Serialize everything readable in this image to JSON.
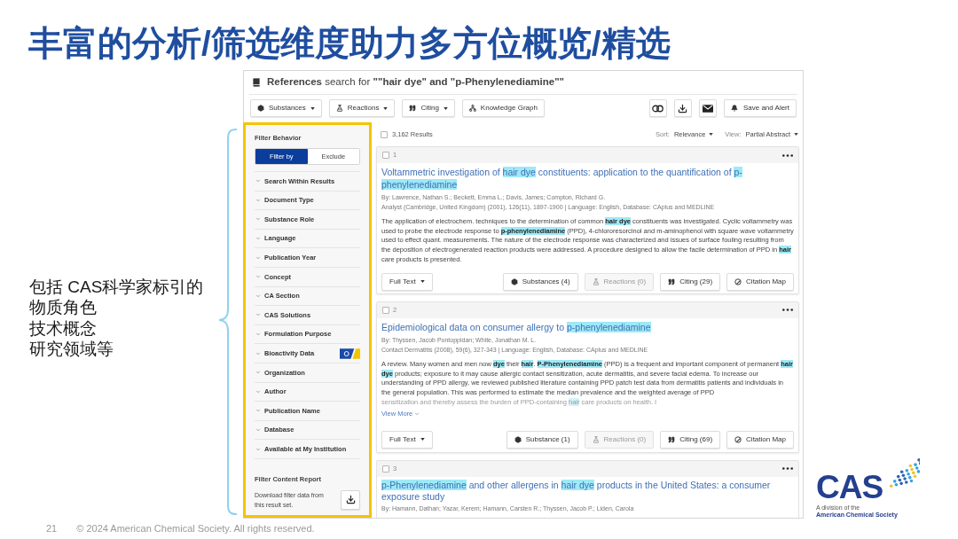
{
  "slide": {
    "title": "丰富的分析/筛选维度助力多方位概览/精选",
    "note_lines": [
      "包括 CAS科学家标引的",
      "物质角色",
      "技术概念",
      "研究领域等"
    ]
  },
  "screen": {
    "heading": "**References** search for **\"\"hair dye\" and \"p-Phenylenediamine\"\"**",
    "toolbar": [
      {
        "label": "Substances",
        "kind": "substances",
        "dropdown": true
      },
      {
        "label": "Reactions",
        "kind": "reactions",
        "dropdown": true
      },
      {
        "label": "Citing",
        "kind": "citing",
        "dropdown": true
      },
      {
        "label": "Knowledge Graph",
        "kind": "graph",
        "dropdown": false
      }
    ],
    "toolbar_right": [
      {
        "kind": "combine"
      },
      {
        "kind": "download"
      },
      {
        "kind": "email"
      },
      {
        "kind": "alert",
        "label": "Save and Alert"
      }
    ]
  },
  "filters": {
    "behavior": {
      "title": "Filter Behavior",
      "options": [
        {
          "label": "Filter by",
          "selected": true
        },
        {
          "label": "Exclude",
          "selected": false
        }
      ]
    },
    "items": [
      {
        "label": "Search Within Results",
        "badge": false
      },
      {
        "label": "Document Type",
        "badge": false
      },
      {
        "label": "Substance Role",
        "badge": false
      },
      {
        "label": "Language",
        "badge": false
      },
      {
        "label": "Publication Year",
        "badge": false
      },
      {
        "label": "Concept",
        "badge": false
      },
      {
        "label": "CA Section",
        "badge": false
      },
      {
        "label": "CAS Solutions",
        "badge": false
      },
      {
        "label": "Formulation Purpose",
        "badge": false
      },
      {
        "label": "Bioactivity Data",
        "badge": true
      },
      {
        "label": "Organization",
        "badge": false
      },
      {
        "label": "Author",
        "badge": false
      },
      {
        "label": "Publication Name",
        "badge": false
      },
      {
        "label": "Database",
        "badge": false
      },
      {
        "label": "Available at My Institution",
        "badge": false
      }
    ],
    "report": {
      "title": "Filter Content Report",
      "text": "Download filter data from this result set."
    }
  },
  "results": {
    "count": "3,162 Results",
    "checked": false,
    "sort": {
      "label": "Sort:",
      "value": "Relevance"
    },
    "view": {
      "label": "View:",
      "value": "Partial Abstract"
    },
    "cards": [
      {
        "number": "1",
        "checked": false,
        "title": [
          {
            "text": "Voltammetric investigation of ",
            "highlighted": false
          },
          {
            "text": "hair dye",
            "highlighted": true
          },
          {
            "text": " constituents: application to the quantification of ",
            "highlighted": false
          },
          {
            "text": "p-phenylenediamine",
            "highlighted": true
          }
        ],
        "authors": "By: Lawrence, Nathan S.; Beckett, Emma L.; Davis, James; Compton, Richard G.",
        "source": "Analyst (Cambridge, United Kingdom) (2001), 126(11), 1897-1900 | Language: English, Database: CAplus and MEDLINE",
        "abstract": [
          {
            "text": "The application of electrochem. techniques to the determination of common ",
            "highlighted": false
          },
          {
            "text": "hair dye",
            "highlighted": true
          },
          {
            "text": " constituents was investigated. Cyclic voltammetry was used to probe the electrode response to ",
            "highlighted": false
          },
          {
            "text": "p-phenylenediamine",
            "highlighted": true
          },
          {
            "text": " (PPD), 4-chlororesorcinol and m-aminophenol with square wave voltammetry used to effect quant. measurements. The nature of the electrode response was characterized and issues of surface fouling resulting from the deposition of electrogenerated reaction products were addressed. A procedure designed to allow the facile determination of PPD in ",
            "highlighted": false
          },
          {
            "text": "hair",
            "highlighted": true
          },
          {
            "text": " care products is presented.",
            "highlighted": false
          }
        ],
        "buttons": [
          {
            "label": "Full Text",
            "kind": "full_text",
            "dropdown": true,
            "disabled": false
          },
          {
            "label": "Substances (4)",
            "kind": "substances",
            "dropdown": false,
            "disabled": false
          },
          {
            "label": "Reactions (0)",
            "kind": "reactions",
            "dropdown": false,
            "disabled": true
          },
          {
            "label": "Citing (29)",
            "kind": "citing",
            "dropdown": false,
            "disabled": false
          },
          {
            "label": "Citation Map",
            "kind": "citation_map",
            "dropdown": false,
            "disabled": false
          }
        ]
      },
      {
        "number": "2",
        "checked": false,
        "title": [
          {
            "text": "Epidemiological data on consumer allergy to ",
            "highlighted": false
          },
          {
            "text": "p-phenylenediamine",
            "highlighted": true
          }
        ],
        "authors": "By: Thyssen, Jacob Pontoppidan; White, Jonathan M. L.",
        "source": "Contact Dermatitis (2008), 59(6), 327-343 | Language: English, Database: CAplus and MEDLINE",
        "abstract": [
          {
            "text": "A review. Many women and men now ",
            "highlighted": false
          },
          {
            "text": "dye",
            "highlighted": true
          },
          {
            "text": " their ",
            "highlighted": false
          },
          {
            "text": "hair",
            "highlighted": true
          },
          {
            "text": ". ",
            "highlighted": false
          },
          {
            "text": "P-Phenylenediamine",
            "highlighted": true
          },
          {
            "text": " (PPD) is a frequent and important component of permanent ",
            "highlighted": false
          },
          {
            "text": "hair dye",
            "highlighted": true
          },
          {
            "text": " products; exposure to it may cause allergic contact sensitization, acute dermatitis, and severe facial edema. To increase our understanding of PPD allergy, we reviewed published literature containing PPD patch test data from dermatitis patients and individuals in the general population. This was performed to estimate the median prevalence and the weighted average of PPD",
            "highlighted": false
          }
        ],
        "abstract_faded": [
          {
            "text": "sensitization and thereby assess the burden of PPD-containing ",
            "highlighted": false
          },
          {
            "text": "hair",
            "highlighted": true
          },
          {
            "text": " care products on health. I",
            "highlighted": false
          }
        ],
        "view_more": "View More",
        "buttons": [
          {
            "label": "Full Text",
            "kind": "full_text",
            "dropdown": true,
            "disabled": false
          },
          {
            "label": "Substance (1)",
            "kind": "substances",
            "dropdown": false,
            "disabled": false
          },
          {
            "label": "Reactions (0)",
            "kind": "reactions",
            "dropdown": false,
            "disabled": true
          },
          {
            "label": "Citing (69)",
            "kind": "citing",
            "dropdown": false,
            "disabled": false
          },
          {
            "label": "Citation Map",
            "kind": "citation_map",
            "dropdown": false,
            "disabled": false
          }
        ]
      },
      {
        "number": "3",
        "checked": false,
        "title": [
          {
            "text": "p-Phenylenediamine",
            "highlighted": true
          },
          {
            "text": " and other allergens in ",
            "highlighted": false
          },
          {
            "text": "hair dye",
            "highlighted": true
          },
          {
            "text": " products in the United States: a consumer exposure study",
            "highlighted": false
          }
        ],
        "authors": "By: Hamann, Dathan; Yazar, Kerem; Hamann, Carsten R.; Thyssen, Jacob P.; Liden, Carola"
      }
    ]
  },
  "logo": {
    "wordmark": "CAS",
    "tagline": [
      "A division of the",
      "American Chemical Society"
    ]
  },
  "footer": {
    "page_number": "21",
    "copyright": "© 2024 American Chemical Society. All rights reserved."
  }
}
